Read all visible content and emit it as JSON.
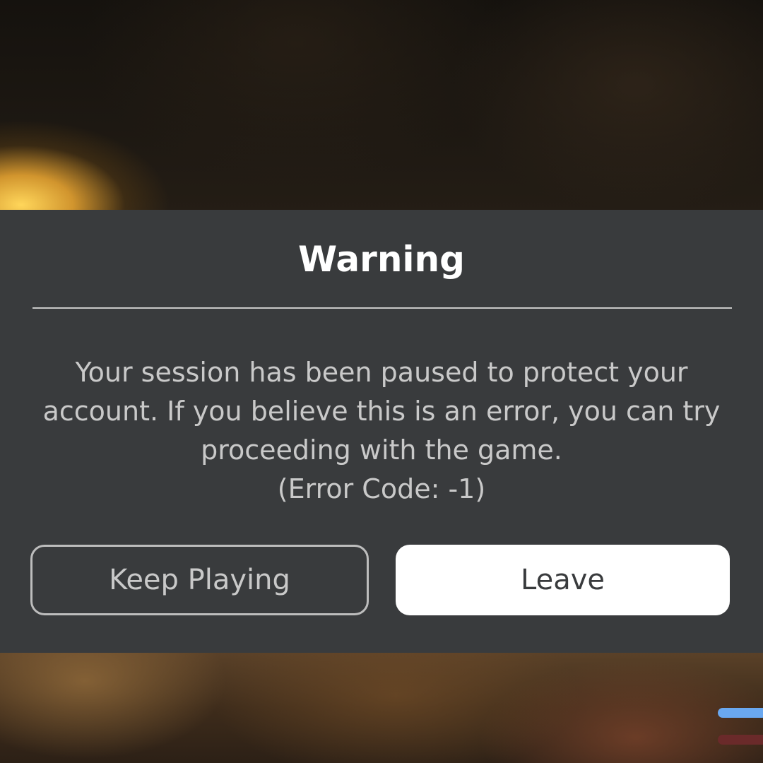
{
  "dialog": {
    "title": "Warning",
    "message_lines": [
      "Your session has been paused to protect your",
      "account. If you believe this is an error, you can try",
      "proceeding with the game.",
      "(Error Code: -1)"
    ],
    "buttons": {
      "keep_playing": "Keep Playing",
      "leave": "Leave"
    }
  },
  "colors": {
    "dialog_bg": "#393b3d",
    "title": "#ffffff",
    "body_text": "#c9c9c9",
    "primary_button_bg": "#ffffff",
    "hud_bar_blue": "#6aa8f0",
    "hud_bar_red": "#6a2a2a"
  }
}
